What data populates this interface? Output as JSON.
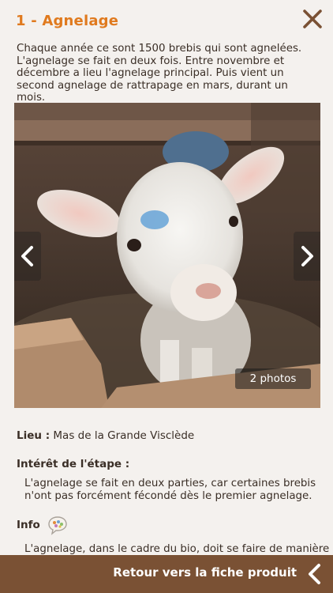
{
  "header": {
    "title": "1 - Agnelage",
    "close_icon": "close-icon",
    "title_color": "#e07a1e"
  },
  "intro": {
    "text": "Chaque année ce sont 1500 brebis qui sont agnelées. L'agnelage se fait en deux fois. Entre novembre et décembre a lieu l'agnelage principal. Puis vient un second agnelage de rattrapage en mars, durant un mois."
  },
  "gallery": {
    "photo_count": "2 photos",
    "prev_icon": "chevron-left-icon",
    "next_icon": "chevron-right-icon"
  },
  "details": {
    "lieu_label": "Lieu :",
    "lieu_value": "Mas de la Grande Visclède",
    "interet_label": "Intérêt de l'étape :",
    "interet_text": "L'agnelage se fait en deux parties, car certaines brebis n'ont pas forcément fécondé dès le premier agnelage.",
    "info_label": "Info",
    "info_icon": "speech-bubble-icon",
    "info_text": "L'agnelage, dans le cadre du bio, doit se faire de manière"
  },
  "footer": {
    "label": "Retour vers la fiche produit",
    "icon": "chevron-left-icon",
    "background": "#7a5134"
  }
}
